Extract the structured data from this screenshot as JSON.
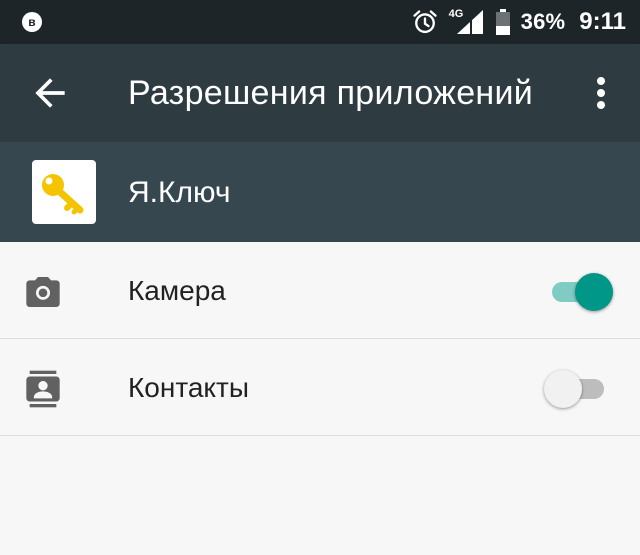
{
  "status_bar": {
    "notification_letter": "в",
    "network": "4G",
    "battery": "36%",
    "time": "9:11"
  },
  "app_bar": {
    "title": "Разрешения приложений"
  },
  "app": {
    "name": "Я.Ключ",
    "accent_color": "#f5c400"
  },
  "permissions": [
    {
      "label": "Камера",
      "enabled": true
    },
    {
      "label": "Контакты",
      "enabled": false
    }
  ],
  "colors": {
    "status_bar": "#1d2529",
    "app_bar": "#2e3b41",
    "app_header": "#37474f",
    "toggle_on": "#009688",
    "toggle_off": "#f1f1f1"
  }
}
